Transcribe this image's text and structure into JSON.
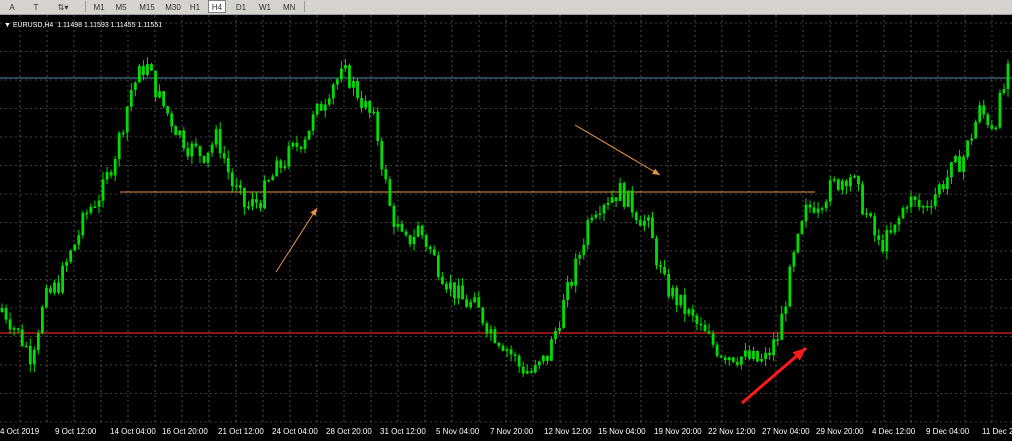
{
  "toolbar": {
    "tools": [
      {
        "name": "text-tool",
        "glyph": "A"
      },
      {
        "name": "text-label-tool",
        "glyph": "T"
      },
      {
        "name": "arrows-tool",
        "glyph": "⇅▾"
      }
    ],
    "timeframes": [
      "M1",
      "M5",
      "M15",
      "M30",
      "H1",
      "H4",
      "D1",
      "W1",
      "MN"
    ],
    "active_timeframe": "H4"
  },
  "chart": {
    "symbol": "EURUSD,H4",
    "ohlc": "1.11498 1.11593 1.11455 1.11551",
    "candle_color": "#00dd00",
    "grid_color": "#808080",
    "resistance_line_color": "#e8954a",
    "support_line_color": "#e02020",
    "top_line_color": "#5a8aa8",
    "annotation_arrow_color": "#e8954a",
    "highlight_arrow_color": "#ff1a1a"
  },
  "x_axis": {
    "labels": [
      "4 Oct 2019",
      "9 Oct 12:00",
      "14 Oct 04:00",
      "16 Oct 20:00",
      "21 Oct 12:00",
      "24 Oct 04:00",
      "28 Oct 20:00",
      "31 Oct 12:00",
      "5 Nov 04:00",
      "7 Nov 20:00",
      "12 Nov 12:00",
      "15 Nov 04:00",
      "19 Nov 20:00",
      "22 Nov 12:00",
      "27 Nov 04:00",
      "29 Nov 20:00",
      "4 Dec 12:00",
      "9 Dec 04:00",
      "11 Dec 2"
    ]
  },
  "chart_data": {
    "type": "candlestick",
    "symbol": "EURUSD,H4",
    "last_bar": {
      "open": 1.11498,
      "high": 1.11593,
      "low": 1.11455,
      "close": 1.11551
    },
    "x_tick_labels": [
      "4 Oct 2019",
      "9 Oct 12:00",
      "14 Oct 04:00",
      "16 Oct 20:00",
      "21 Oct 12:00",
      "24 Oct 04:00",
      "28 Oct 20:00",
      "31 Oct 12:00",
      "5 Nov 04:00",
      "7 Nov 20:00",
      "12 Nov 12:00",
      "15 Nov 04:00",
      "19 Nov 20:00",
      "22 Nov 12:00",
      "27 Nov 04:00",
      "29 Nov 20:00",
      "4 Dec 12:00",
      "9 Dec 04:00",
      "11 Dec 2"
    ],
    "price_path_shape": [
      0.28,
      0.22,
      0.15,
      0.3,
      0.35,
      0.45,
      0.55,
      0.6,
      0.72,
      0.88,
      0.95,
      0.85,
      0.78,
      0.72,
      0.7,
      0.75,
      0.62,
      0.55,
      0.58,
      0.65,
      0.7,
      0.75,
      0.82,
      0.9,
      0.92,
      0.85,
      0.78,
      0.55,
      0.45,
      0.5,
      0.42,
      0.35,
      0.3,
      0.28,
      0.22,
      0.18,
      0.12,
      0.1,
      0.15,
      0.28,
      0.4,
      0.55,
      0.58,
      0.6,
      0.55,
      0.5,
      0.35,
      0.3,
      0.25,
      0.2,
      0.16,
      0.15,
      0.14,
      0.13,
      0.2,
      0.4,
      0.55,
      0.58,
      0.62,
      0.65,
      0.55,
      0.45,
      0.48,
      0.58,
      0.55,
      0.6,
      0.65,
      0.7,
      0.82,
      0.78,
      0.92
    ],
    "grid": true,
    "horizontal_lines": [
      "top-reference",
      "resistance",
      "support"
    ]
  }
}
